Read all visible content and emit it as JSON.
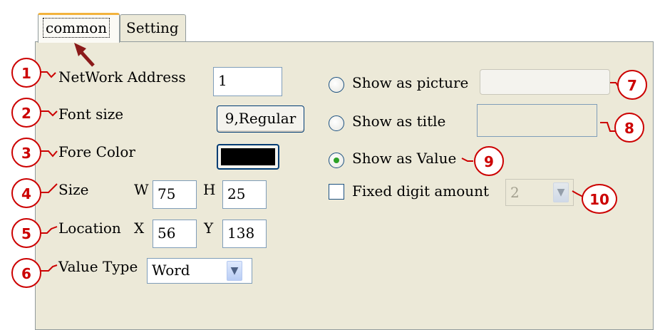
{
  "tabs": {
    "common": "common",
    "setting": "Setting"
  },
  "labels": {
    "network_address": "NetWork Address",
    "font_size": "Font size",
    "fore_color": "Fore Color",
    "size": "Size",
    "w": "W",
    "h": "H",
    "location": "Location",
    "x": "X",
    "y": "Y",
    "value_type": "Value Type",
    "show_picture": "Show as picture",
    "show_title": "Show as title",
    "show_value": "Show as Value",
    "fixed_digit": "Fixed digit amount"
  },
  "fields": {
    "network_address": "1",
    "font_button": "9,Regular",
    "fore_color": "#000000",
    "width": "75",
    "height": "25",
    "loc_x": "56",
    "loc_y": "138",
    "value_type": "Word",
    "digit_amount": "2",
    "picture_path": "",
    "title_text": ""
  },
  "state": {
    "show_mode": "Show as Value",
    "fixed_digit_checked": false
  },
  "callouts": [
    "1",
    "2",
    "3",
    "4",
    "5",
    "6",
    "7",
    "8",
    "9",
    "10"
  ],
  "colors": {
    "callout": "#cc0000",
    "panel": "#ece9d8",
    "tab_highlight": "#f2b33d",
    "radio_dot": "#2da127"
  },
  "icons": {
    "dropdown": "chevron-down-icon",
    "pointer": "arrow-icon"
  }
}
